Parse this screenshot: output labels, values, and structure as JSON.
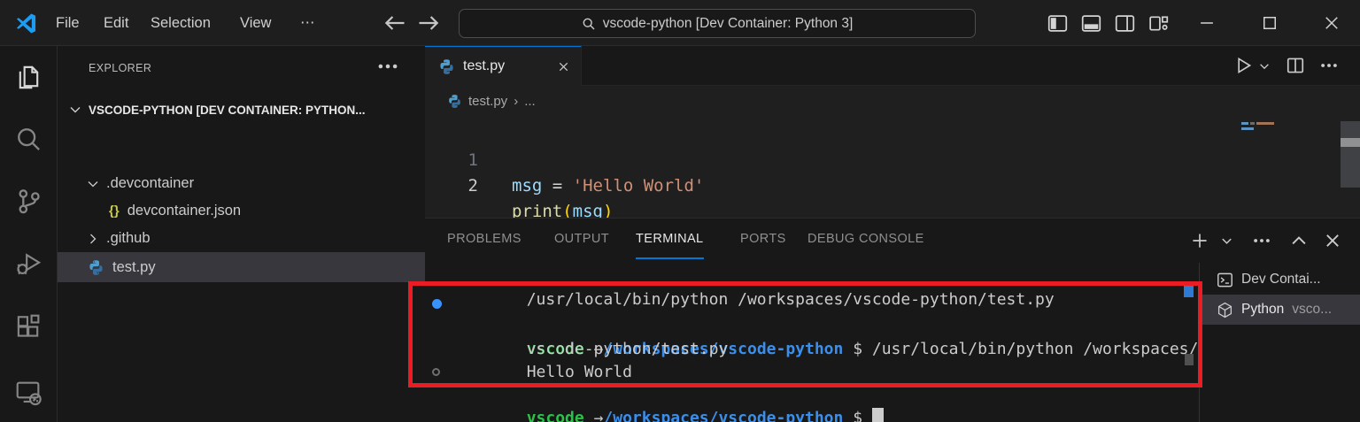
{
  "window": {
    "menus": [
      "File",
      "Edit",
      "Selection",
      "View"
    ],
    "menu_more": "⋯",
    "back_arrow": "←",
    "forward_arrow": "→",
    "command_center": "vscode-python [Dev Container: Python 3]"
  },
  "activity_bar": {
    "items": [
      "explorer",
      "search",
      "source-control",
      "run-and-debug",
      "extensions",
      "remote-explorer"
    ]
  },
  "explorer": {
    "title": "EXPLORER",
    "more": "⋯",
    "section": "VSCODE-PYTHON [DEV CONTAINER: PYTHON...",
    "json_icon_glyph": "{}",
    "items": [
      {
        "label": ".devcontainer"
      },
      {
        "label": "devcontainer.json"
      },
      {
        "label": ".github"
      },
      {
        "label": "test.py"
      }
    ]
  },
  "editor": {
    "tab_label": "test.py",
    "tab_close": "✕",
    "breadcrumb_file": "test.py",
    "breadcrumb_separator": "›",
    "breadcrumb_ellipsis": "...",
    "lines": [
      {
        "num": "1",
        "t0": "msg",
        "t1": " = ",
        "t2": "'Hello World'"
      },
      {
        "num": "2",
        "t0": "print",
        "t1": "(",
        "t2": "msg",
        "t3": ")"
      }
    ]
  },
  "panel": {
    "tabs": [
      "PROBLEMS",
      "OUTPUT",
      "TERMINAL",
      "PORTS",
      "DEBUG CONSOLE"
    ],
    "active_tab": "TERMINAL",
    "actions_more": "⋯"
  },
  "terminal": {
    "history_line": "/usr/local/bin/python /workspaces/vscode-python/test.py",
    "prompt_user": "vscode",
    "prompt_arrow": " →",
    "prompt_path": "/workspaces/vscode-python",
    "prompt_dollar": " $ ",
    "command": "/usr/local/bin/python /workspaces/",
    "command_wrap": "vscode-python/test.py",
    "output": "Hello World"
  },
  "terminal_list": {
    "rows": [
      {
        "label": "Dev Contai...",
        "detail": ""
      },
      {
        "label": "Python",
        "detail": "vsco..."
      }
    ]
  },
  "colors": {
    "accent": "#0078d4",
    "annotation_red": "#ea1c24",
    "prompt_green": "#2bc24a",
    "prompt_blue": "#3b8eea",
    "decoration_blue": "#3794ff",
    "editor_bg": "#1f1f1f",
    "chrome_bg": "#181818"
  }
}
